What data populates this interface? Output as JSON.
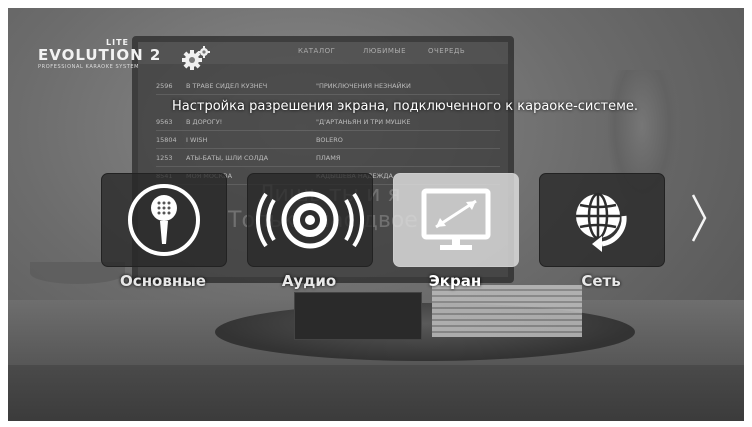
{
  "app": {
    "logo_main": "EVOLUTION 2",
    "logo_badge": "LITE",
    "logo_subtitle": "PROFESSIONAL KARAOKE SYSTEM"
  },
  "description": "Настройка разрешения экрана, подключенного к караоке-системе.",
  "menu": {
    "items": [
      {
        "label": "Основные",
        "icon": "microphone-icon",
        "selected": false
      },
      {
        "label": "Аудио",
        "icon": "speaker-icon",
        "selected": false
      },
      {
        "label": "Экран",
        "icon": "monitor-resize-icon",
        "selected": true
      },
      {
        "label": "Сеть",
        "icon": "globe-network-icon",
        "selected": false
      }
    ],
    "next_icon": "chevron-right-icon"
  },
  "background": {
    "tabs": [
      "КАТАЛОГ",
      "ЛЮБИМЫЕ",
      "ОЧЕРЕДЬ"
    ],
    "rows": [
      {
        "num": "2596",
        "title": "В ТРАВЕ СИДЕЛ КУЗНЕЧ",
        "artist": "\"ПРИКЛЮЧЕНИЯ НЕЗНАЙКИ"
      },
      {
        "num": "9563",
        "title": "В ДОРОГУ!",
        "artist": "\"Д'АРТАНЬЯН И ТРИ МУШКЕ"
      },
      {
        "num": "15804",
        "title": "I WISH",
        "artist": "BOLERO"
      },
      {
        "num": "1253",
        "title": "АТЫ-БАТЫ, ШЛИ СОЛДА",
        "artist": "ПЛАМЯ"
      },
      {
        "num": "8541",
        "title": "МОЯ МОСКВА",
        "artist": "КАДЫШЕВА НАДЕЖДА"
      }
    ],
    "lyric_line1": "Лишь ты и я",
    "lyric_line2": "Только нас двое"
  },
  "colors": {
    "tile_bg": "#2d2d2d",
    "tile_selected_bg": "#e1e1e1",
    "text": "#ffffff"
  }
}
